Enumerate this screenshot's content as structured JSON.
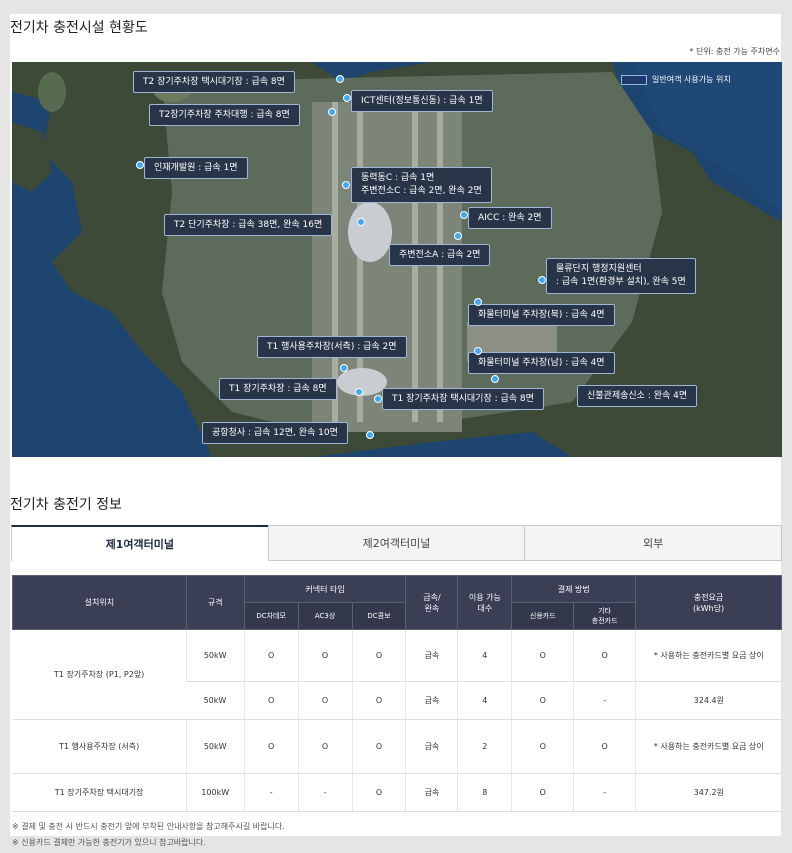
{
  "page": {
    "title": "전기차 충전시설 현황도",
    "unit": "* 단위: 충전 가능 주차면수",
    "info_title": "전기차 충전기 정보"
  },
  "map": {
    "legend": "일반여객 사용가능 위치",
    "labels": [
      {
        "id": "t2-taxi",
        "text": "T2 장기주차장 택시대기장 : 급속 8면"
      },
      {
        "id": "t2-valet",
        "text": "T2장기주차장 주차대행 : 급속 8면"
      },
      {
        "id": "ict",
        "text": "ICT센터(정보통신동) : 급속 1면"
      },
      {
        "id": "hr",
        "text": "인재개발원 : 급속 1면"
      },
      {
        "id": "power-c",
        "text": "동력동C : 급속 1면"
      },
      {
        "id": "power-c2",
        "text": "주변전소C : 급속 2면, 완속 2면"
      },
      {
        "id": "t2-short",
        "text": "T2 단기주차장 : 급속 38면, 완속 16면"
      },
      {
        "id": "aicc",
        "text": "AICC : 완속 2면"
      },
      {
        "id": "sub-a",
        "text": "주변전소A : 급속 2면"
      },
      {
        "id": "logi-1",
        "text": "물류단지 행정지원센터"
      },
      {
        "id": "logi-2",
        "text": ": 급속 1면(환경부 설치), 완속 5면"
      },
      {
        "id": "cargo-n",
        "text": "화물터미널 주차장(북) : 급속 4면"
      },
      {
        "id": "t1-admin",
        "text": "T1 행사용주차장(서측) : 급속 2면"
      },
      {
        "id": "cargo-s",
        "text": "화물터미널 주차장(남) : 급속 4면"
      },
      {
        "id": "t1-long",
        "text": "T1 장기주차장 : 급속 8면"
      },
      {
        "id": "t1-taxi",
        "text": "T1 장기주차장 택시대기장 : 급속 8면"
      },
      {
        "id": "ctrl",
        "text": "신불관제송신소 : 완속 4면"
      },
      {
        "id": "office",
        "text": "공항청사 : 급속 12면, 완속 10면"
      }
    ]
  },
  "tabs": [
    "제1여객터미널",
    "제2여객터미널",
    "외부"
  ],
  "table": {
    "headers": {
      "location": "설치위치",
      "spec": "규격",
      "connector": "커넥터 타입",
      "dc_chademo": "DC차데모",
      "ac3": "AC3상",
      "dc_combo": "DC콤보",
      "speed": "급속/\n완속",
      "count": "이용 가능\n대수",
      "payment": "결제 방법",
      "credit": "신용카드",
      "other_card": "기타\n충전카드",
      "fee": "충전요금\n(kWh당)"
    },
    "rows": [
      {
        "loc": "T1 장기주차장 (P1, P2앞)",
        "spec": "50kW",
        "c1": "O",
        "c2": "O",
        "c3": "O",
        "speed": "급속",
        "count": "4",
        "credit": "O",
        "other": "O",
        "fee": "* 사용하는 충전카드별 요금 상이"
      },
      {
        "loc": "",
        "spec": "50kW",
        "c1": "O",
        "c2": "O",
        "c3": "O",
        "speed": "급속",
        "count": "4",
        "credit": "O",
        "other": "-",
        "fee": "324.4원"
      },
      {
        "loc": "T1 행사용주차장 (서측)",
        "spec": "50kW",
        "c1": "O",
        "c2": "O",
        "c3": "O",
        "speed": "급속",
        "count": "2",
        "credit": "O",
        "other": "O",
        "fee": "* 사용하는 충전카드별 요금 상이"
      },
      {
        "loc": "T1 장기주차장 택시대기장",
        "spec": "100kW",
        "c1": "-",
        "c2": "-",
        "c3": "O",
        "speed": "급속",
        "count": "8",
        "credit": "O",
        "other": "-",
        "fee": "347.2원"
      }
    ]
  },
  "notes": [
    "※ 결제 및 충전 시 반드시 충전기 앞에 부착된 안내사항을 참고해주시길 바랍니다.",
    "※ 신용카드 결제만 가능한 충전기가 있으니 참고바랍니다."
  ]
}
